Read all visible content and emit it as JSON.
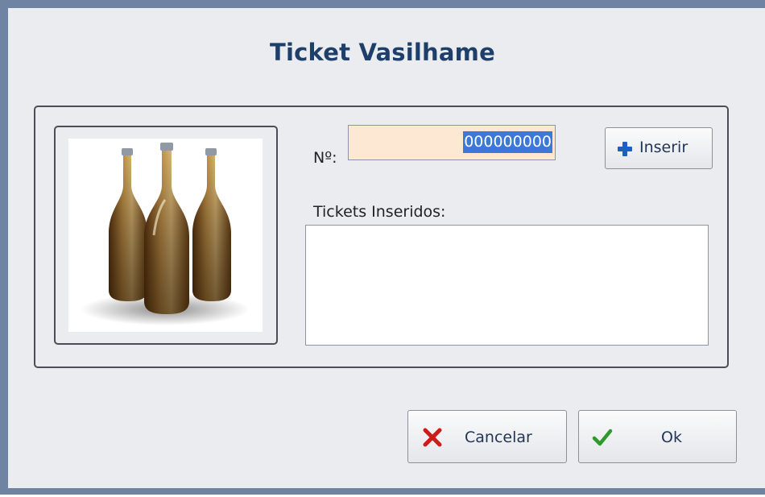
{
  "dialog": {
    "title": "Ticket Vasilhame",
    "number_label": "Nº:",
    "number_value": "000000000",
    "insert_button": "Inserir",
    "list_label": "Tickets Inseridos:",
    "cancel_button": "Cancelar",
    "ok_button": "Ok"
  },
  "icons": {
    "image": "beer-bottles-image",
    "insert": "plus-icon",
    "cancel": "x-icon",
    "ok": "check-icon"
  },
  "colors": {
    "title": "#1f3f6b",
    "input_bg": "#fde8d4",
    "selection": "#3b78d8",
    "plus": "#1f5fbf",
    "cancel_x": "#d11a1a",
    "ok_check": "#2e9a2e"
  }
}
